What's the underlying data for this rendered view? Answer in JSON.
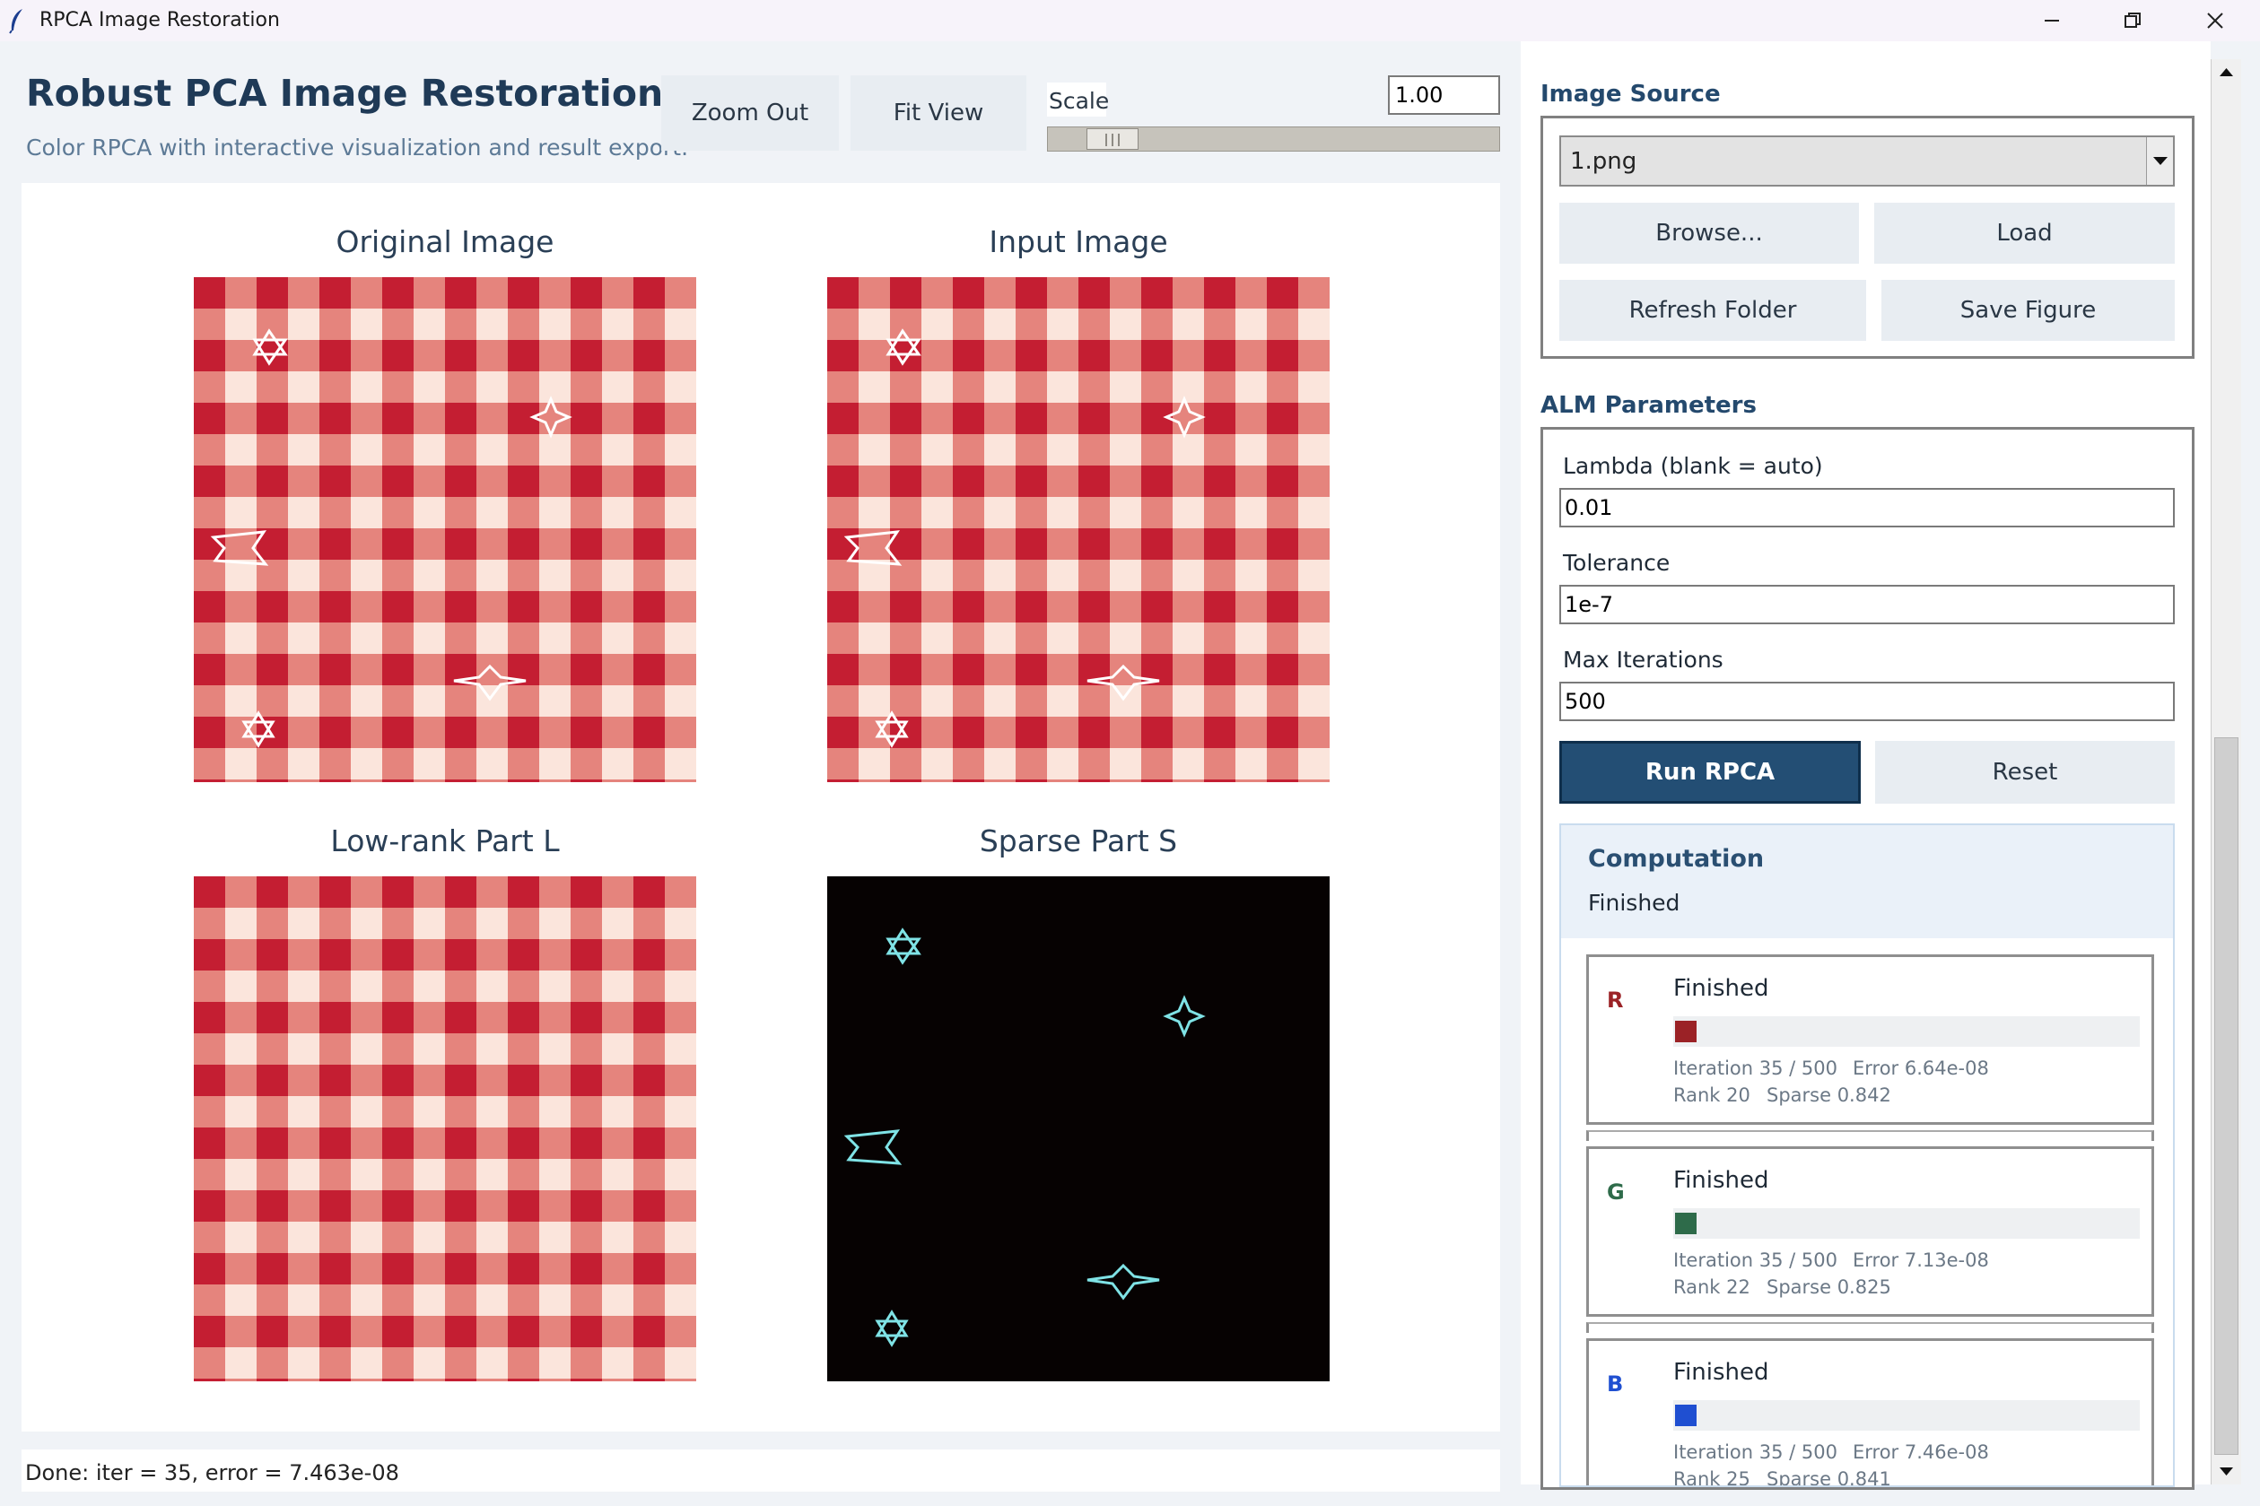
{
  "window": {
    "title": "RPCA Image Restoration"
  },
  "header": {
    "title": "Robust PCA Image Restoration",
    "subtitle": "Color RPCA with interactive visualization and result export."
  },
  "toolbar": {
    "zoom_out": "Zoom Out",
    "fit_view": "Fit View",
    "scale_label": "Scale",
    "scale_value": "1.00",
    "scale_slider_value": 1.0
  },
  "panels": {
    "original": "Original Image",
    "input": "Input Image",
    "lowrank": "Low-rank Part L",
    "sparse": "Sparse Part S"
  },
  "status_bar": "Done: iter = 35, error = 7.463e-08",
  "image_source": {
    "label": "Image Source",
    "selected": "1.png",
    "browse": "Browse...",
    "load": "Load",
    "refresh": "Refresh Folder",
    "save": "Save Figure"
  },
  "alm": {
    "label": "ALM Parameters",
    "lambda_label": "Lambda (blank = auto)",
    "lambda_value": "0.01",
    "tol_label": "Tolerance",
    "tol_value": "1e-7",
    "maxit_label": "Max Iterations",
    "maxit_value": "500",
    "run": "Run RPCA",
    "reset": "Reset"
  },
  "computation": {
    "title": "Computation",
    "status": "Finished",
    "channels": [
      {
        "letter": "R",
        "color": "#9b2226",
        "status": "Finished",
        "iteration": "Iteration 35 / 500",
        "error": "Error 6.64e-08",
        "rank": "Rank 20",
        "sparse": "Sparse 0.842"
      },
      {
        "letter": "G",
        "color": "#2e6b4a",
        "status": "Finished",
        "iteration": "Iteration 35 / 500",
        "error": "Error 7.13e-08",
        "rank": "Rank 22",
        "sparse": "Sparse 0.825"
      },
      {
        "letter": "B",
        "color": "#1f4fd1",
        "status": "Finished",
        "iteration": "Iteration 35 / 500",
        "error": "Error 7.46e-08",
        "rank": "Rank 25",
        "sparse": "Sparse 0.841"
      }
    ]
  }
}
